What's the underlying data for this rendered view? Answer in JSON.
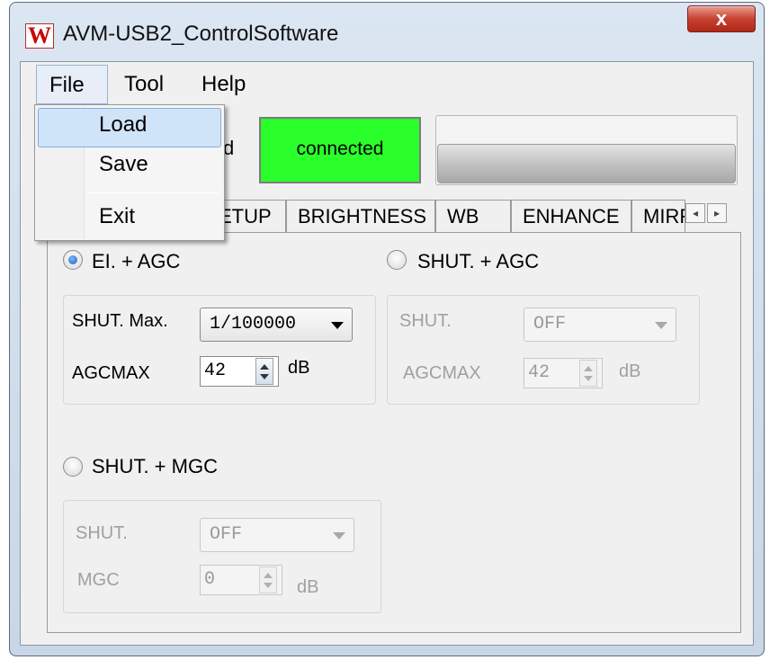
{
  "window": {
    "title": "AVM-USB2_ControlSoftware",
    "close_glyph": "x",
    "app_icon_letter": "W"
  },
  "menubar": {
    "file": "File",
    "tool": "Tool",
    "help": "Help"
  },
  "file_menu": {
    "items": [
      "Load",
      "Save",
      "Exit"
    ],
    "highlighted": "Load"
  },
  "status": {
    "partial_label": "d",
    "connection": "connected",
    "connection_color": "#2bff2b"
  },
  "tabs": {
    "items": [
      "ETUP",
      "BRIGHTNESS",
      "WB",
      "ENHANCE",
      "MIRF"
    ],
    "scroll_left": "◂",
    "scroll_right": "▸"
  },
  "modes": {
    "ei_agc": {
      "label": "EI. + AGC",
      "selected": true,
      "shut_max_label": "SHUT. Max.",
      "shut_max_value": "1/100000",
      "agcmax_label": "AGCMAX",
      "agcmax_value": "42",
      "agcmax_unit": "dB"
    },
    "shut_agc": {
      "label": "SHUT. + AGC",
      "selected": false,
      "shut_label": "SHUT.",
      "shut_value": "OFF",
      "agcmax_label": "AGCMAX",
      "agcmax_value": "42",
      "agcmax_unit": "dB"
    },
    "shut_mgc": {
      "label": "SHUT. + MGC",
      "selected": false,
      "shut_label": "SHUT.",
      "shut_value": "OFF",
      "mgc_label": "MGC",
      "mgc_value": "0",
      "mgc_unit": "dB"
    }
  }
}
